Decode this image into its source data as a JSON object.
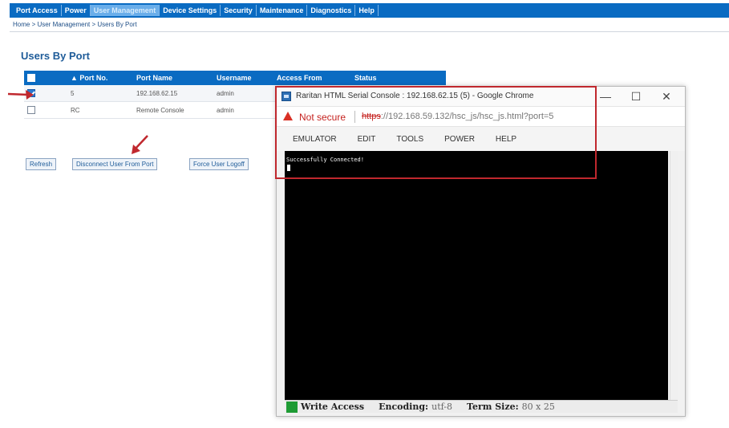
{
  "nav": {
    "tabs": [
      {
        "label": "Port Access"
      },
      {
        "label": "Power"
      },
      {
        "label": "User Management"
      },
      {
        "label": "Device Settings"
      },
      {
        "label": "Security"
      },
      {
        "label": "Maintenance"
      },
      {
        "label": "Diagnostics"
      },
      {
        "label": "Help"
      }
    ],
    "active_tab": "User Management"
  },
  "breadcrumb": "Home > User Management > Users By Port",
  "page_title": "Users By Port",
  "table": {
    "headers": [
      "▲ Port No.",
      "Port Name",
      "Username",
      "Access From",
      "Status"
    ],
    "rows": [
      {
        "checked": true,
        "port_no": "5",
        "port_name": "192.168.62.15",
        "username": "admin"
      },
      {
        "checked": false,
        "port_no": "RC",
        "port_name": "Remote Console",
        "username": "admin"
      }
    ]
  },
  "buttons": {
    "refresh": "Refresh",
    "disconnect": "Disconnect User From Port",
    "force_logoff": "Force User Logoff"
  },
  "popup": {
    "title": "Raritan HTML Serial Console : 192.168.62.15 (5) - Google Chrome",
    "not_secure": "Not secure",
    "url_scheme": "https",
    "url_rest": "://192.168.59.132/hsc_js/hsc_js.html?port=5",
    "controls": {
      "minimize": "—",
      "maximize": "☐",
      "close": "✕"
    },
    "menu": [
      "EMULATOR",
      "EDIT",
      "TOOLS",
      "POWER",
      "HELP"
    ],
    "terminal_text": "Successfully Connected!",
    "status": {
      "write_access": "Write Access",
      "encoding_label": "Encoding:",
      "encoding_value": "utf-8",
      "term_size_label": "Term Size:",
      "term_size_value": "80 x 25"
    }
  },
  "colors": {
    "nav_blue": "#0a6bc2",
    "annotation_red": "#c0282e",
    "write_access_green": "#1e9b34"
  }
}
